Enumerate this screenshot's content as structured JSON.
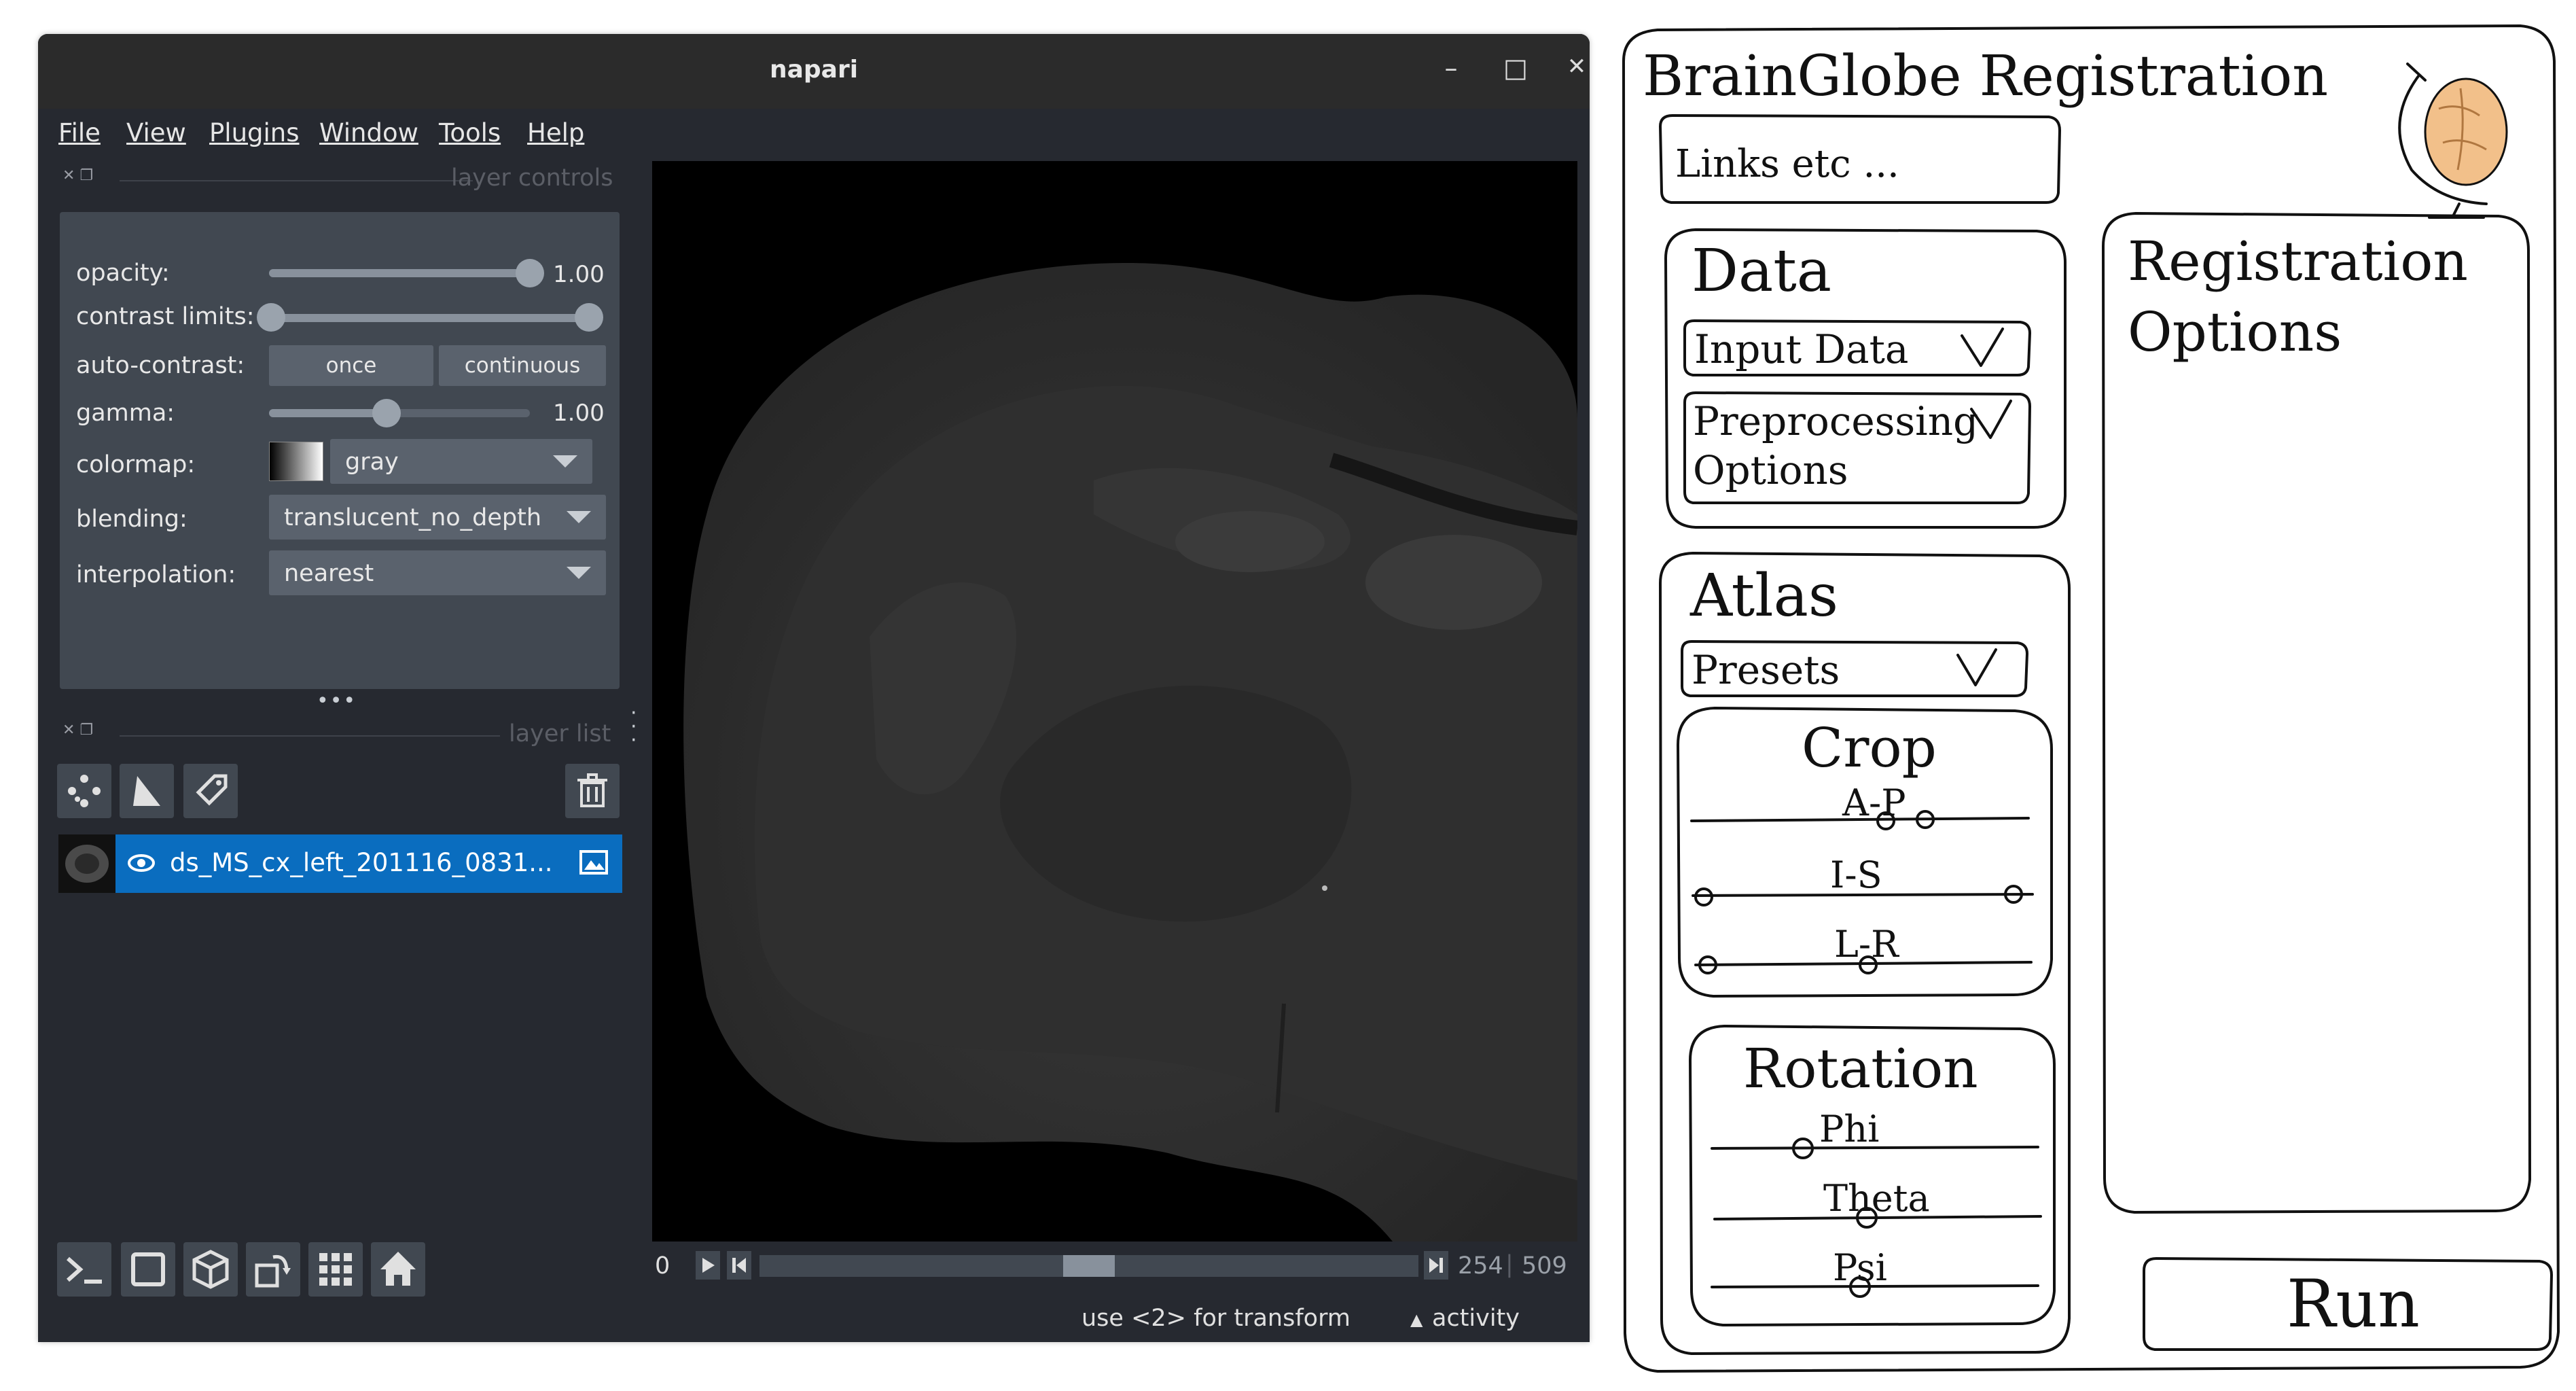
{
  "napari": {
    "title": "napari",
    "window_buttons": [
      "–",
      "□",
      "✕"
    ],
    "menu": [
      "File",
      "View",
      "Plugins",
      "Window",
      "Tools",
      "Help"
    ],
    "layer_controls": {
      "dock_title": "layer controls",
      "opacity": {
        "label": "opacity:",
        "value": "1.00",
        "level": 1.0
      },
      "contrast_limits": {
        "label": "contrast limits:",
        "low": 0.0,
        "high": 1.0
      },
      "auto_contrast": {
        "label": "auto-contrast:",
        "once": "once",
        "continuous": "continuous"
      },
      "gamma": {
        "label": "gamma:",
        "value": "1.00",
        "level": 0.45
      },
      "colormap": {
        "label": "colormap:",
        "value": "gray"
      },
      "blending": {
        "label": "blending:",
        "value": "translucent_no_depth"
      },
      "interpolation": {
        "label": "interpolation:",
        "value": "nearest"
      },
      "resize_handle": "•••"
    },
    "layer_list": {
      "dock_title": "layer list",
      "layers": [
        {
          "name": "ds_MS_cx_left_201116_0831...",
          "selected": true,
          "visible": true
        }
      ]
    },
    "dims": {
      "start": "0",
      "current": "254",
      "max": "509",
      "position": 0.5
    },
    "status": {
      "hint": "use <2> for transform",
      "activity": "activity"
    }
  },
  "sketch": {
    "title": "BrainGlobe Registration",
    "links": "Links etc ...",
    "data_section": {
      "title": "Data",
      "input": "Input Data",
      "preprocessing_line1": "Preprocessing",
      "preprocessing_line2": "Options"
    },
    "atlas_section": {
      "title": "Atlas",
      "presets": "Presets"
    },
    "crop_section": {
      "title": "Crop",
      "sliders": [
        "A-P",
        "I-S",
        "L-R"
      ]
    },
    "rotation_section": {
      "title": "Rotation",
      "sliders": [
        "Phi",
        "Theta",
        "Psi"
      ]
    },
    "registration_options_line1": "Registration",
    "registration_options_line2": "Options",
    "run": "Run"
  }
}
